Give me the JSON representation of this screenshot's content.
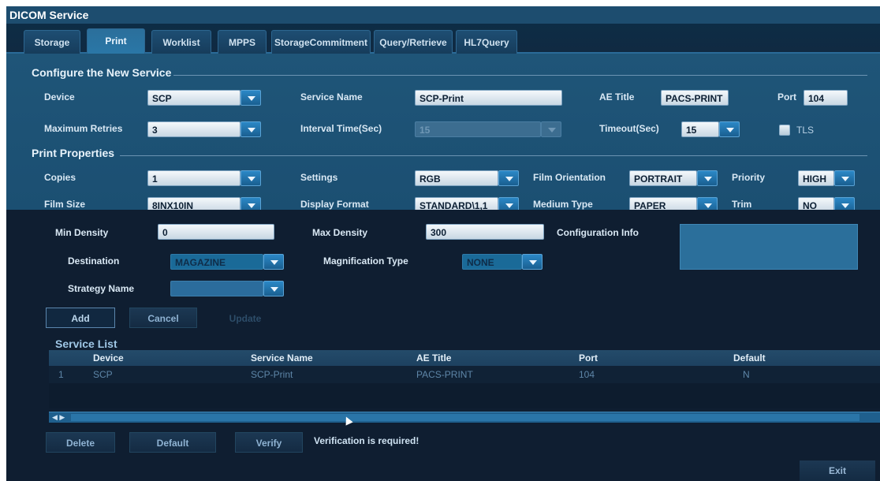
{
  "window": {
    "title": "DICOM Service"
  },
  "tabs": [
    {
      "label": "Storage"
    },
    {
      "label": "Print",
      "active": true
    },
    {
      "label": "Worklist"
    },
    {
      "label": "MPPS"
    },
    {
      "label": "StorageCommitment"
    },
    {
      "label": "Query/Retrieve"
    },
    {
      "label": "HL7Query"
    }
  ],
  "configure": {
    "title": "Configure the New Service",
    "device_label": "Device",
    "device_value": "SCP",
    "service_name_label": "Service Name",
    "service_name_value": "SCP-Print",
    "ae_title_label": "AE Title",
    "ae_title_value": "PACS-PRINT",
    "port_label": "Port",
    "port_value": "104",
    "max_retries_label": "Maximum Retries",
    "max_retries_value": "3",
    "interval_label": "Interval Time(Sec)",
    "interval_value": "15",
    "timeout_label": "Timeout(Sec)",
    "timeout_value": "15",
    "tls_label": "TLS"
  },
  "print_properties": {
    "title": "Print Properties",
    "copies_label": "Copies",
    "copies_value": "1",
    "settings_label": "Settings",
    "settings_value": "RGB",
    "film_orientation_label": "Film Orientation",
    "film_orientation_value": "PORTRAIT",
    "priority_label": "Priority",
    "priority_value": "HIGH",
    "film_size_label": "Film Size",
    "film_size_value": "8INX10IN",
    "display_format_label": "Display Format",
    "display_format_value": "STANDARD\\1,1",
    "medium_type_label": "Medium Type",
    "medium_type_value": "PAPER",
    "trim_label": "Trim",
    "trim_value": "NO",
    "min_density_label": "Min Density",
    "min_density_value": "0",
    "max_density_label": "Max Density",
    "max_density_value": "300",
    "config_info_label": "Configuration Info",
    "destination_label": "Destination",
    "destination_value": "MAGAZINE",
    "magnification_label": "Magnification Type",
    "magnification_value": "NONE",
    "strategy_label": "Strategy Name",
    "strategy_value": ""
  },
  "actions": {
    "add": "Add",
    "cancel": "Cancel",
    "update": "Update"
  },
  "service_list": {
    "title": "Service List",
    "columns": [
      "Device",
      "Service Name",
      "AE Title",
      "Port",
      "Default"
    ],
    "rows": [
      {
        "index": "1",
        "device": "SCP",
        "service_name": "SCP-Print",
        "ae_title": "PACS-PRINT",
        "port": "104",
        "default": "N"
      }
    ]
  },
  "bottom": {
    "delete": "Delete",
    "default": "Default",
    "verify": "Verify",
    "verify_msg": "Verification is required!",
    "exit": "Exit"
  },
  "colors": {
    "accent": "#2a77a7",
    "panel": "#1f5578",
    "background": "#0f1e31"
  }
}
